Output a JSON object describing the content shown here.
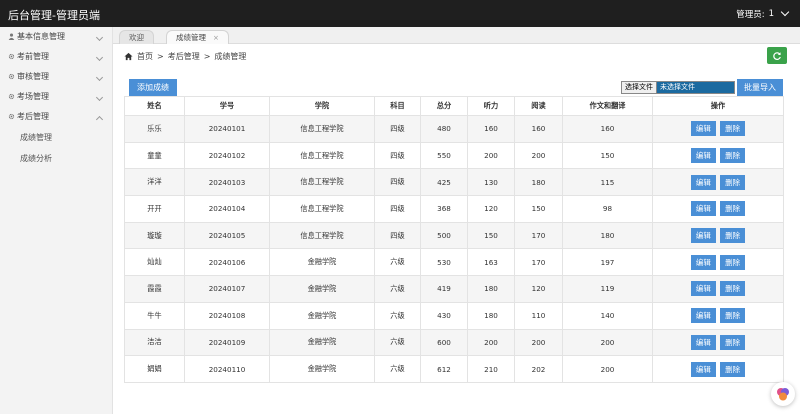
{
  "app": {
    "title": "后台管理-管理员端",
    "admin_label": "管理员:",
    "admin_value": "1"
  },
  "sidebar": {
    "items": [
      {
        "label": "基本信息管理",
        "icon": "person-icon",
        "expanded": false
      },
      {
        "label": "考前管理",
        "icon": "gear-icon",
        "expanded": false
      },
      {
        "label": "审核管理",
        "icon": "gear-icon",
        "expanded": false
      },
      {
        "label": "考场管理",
        "icon": "gear-icon",
        "expanded": false
      },
      {
        "label": "考后管理",
        "icon": "gear-icon",
        "expanded": true
      }
    ],
    "sub_items": [
      "成绩管理",
      "成绩分析"
    ]
  },
  "tabs": [
    {
      "label": "欢迎",
      "active": false
    },
    {
      "label": "成绩管理",
      "active": true,
      "close": "×"
    }
  ],
  "breadcrumb": {
    "home": "首页",
    "sep": ">",
    "level1": "考后管理",
    "level2": "成绩管理"
  },
  "toolbar": {
    "add_label": "添加成绩",
    "file_button": "选择文件",
    "file_status": "未选择文件",
    "import_label": "批量导入"
  },
  "table": {
    "headers": [
      "姓名",
      "学号",
      "学院",
      "科目",
      "总分",
      "听力",
      "阅读",
      "作文和翻译",
      "操作"
    ],
    "edit_label": "编辑",
    "delete_label": "删除",
    "rows": [
      [
        "乐乐",
        "20240101",
        "信息工程学院",
        "四级",
        "480",
        "160",
        "160",
        "160"
      ],
      [
        "童童",
        "20240102",
        "信息工程学院",
        "四级",
        "550",
        "200",
        "200",
        "150"
      ],
      [
        "洋洋",
        "20240103",
        "信息工程学院",
        "四级",
        "425",
        "130",
        "180",
        "115"
      ],
      [
        "开开",
        "20240104",
        "信息工程学院",
        "四级",
        "368",
        "120",
        "150",
        "98"
      ],
      [
        "璇璇",
        "20240105",
        "信息工程学院",
        "四级",
        "500",
        "150",
        "170",
        "180"
      ],
      [
        "灿灿",
        "20240106",
        "金融学院",
        "六级",
        "530",
        "163",
        "170",
        "197"
      ],
      [
        "霞霞",
        "20240107",
        "金融学院",
        "六级",
        "419",
        "180",
        "120",
        "119"
      ],
      [
        "牛牛",
        "20240108",
        "金融学院",
        "六级",
        "430",
        "180",
        "110",
        "140"
      ],
      [
        "洁洁",
        "20240109",
        "金融学院",
        "六级",
        "600",
        "200",
        "200",
        "200"
      ],
      [
        "娟娟",
        "20240110",
        "金融学院",
        "六级",
        "612",
        "210",
        "202",
        "200"
      ]
    ]
  },
  "colors": {
    "topbar": "#1f1f1f",
    "primary": "#4a8fd6",
    "refresh": "#3aa24a"
  }
}
